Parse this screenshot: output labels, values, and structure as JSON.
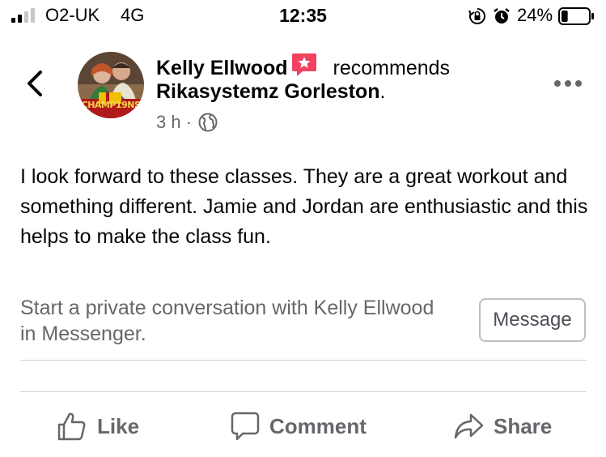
{
  "status_bar": {
    "carrier": "O2-UK",
    "network": "4G",
    "time": "12:35",
    "battery_percent": "24%",
    "battery_level": 0.24,
    "icons": [
      "signal-icon",
      "rotation-lock-icon",
      "alarm-icon",
      "battery-icon"
    ]
  },
  "header": {
    "author": "Kelly Ellwood",
    "action": "recommends",
    "page_name": "Rikasystemz Gorleston",
    "trailing_punct": ".",
    "time_ago": "3 h",
    "separator": "·",
    "icons": [
      "back-chevron-icon",
      "recommendation-star-icon",
      "globe-icon",
      "more-dots-icon"
    ],
    "avatar_caption": "CHAMP19NS"
  },
  "post": {
    "body": "I look forward to these classes. They are a great workout and something different. Jamie and Jordan are enthusiastic and this helps to make the class fun."
  },
  "messenger_cta": {
    "text": "Start a private conversation with Kelly Ellwood in Messenger.",
    "button_label": "Message"
  },
  "actions": {
    "like": "Like",
    "comment": "Comment",
    "share": "Share",
    "icons": [
      "thumbs-up-icon",
      "comment-bubble-icon",
      "share-arrow-icon"
    ]
  },
  "colors": {
    "text": "#050505",
    "secondary_text": "#65676b",
    "badge": "#f3425f",
    "divider": "#ced0d4",
    "button_border": "#bcc0c4"
  }
}
